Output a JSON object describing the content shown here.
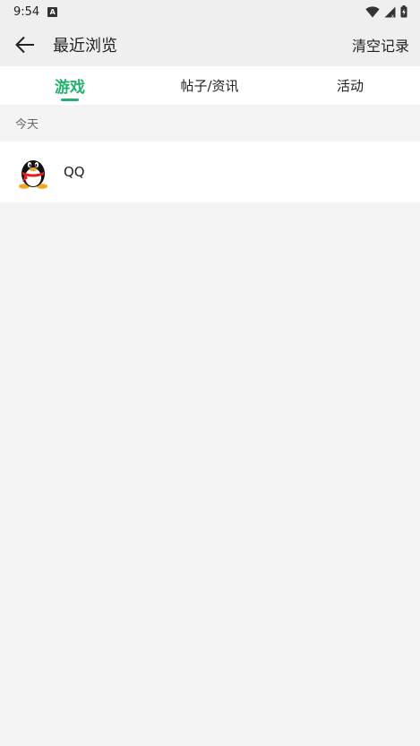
{
  "status_bar": {
    "time": "9:54",
    "notification_icon": "A"
  },
  "app_bar": {
    "title": "最近浏览",
    "clear_label": "清空记录"
  },
  "tabs": [
    {
      "label": "游戏",
      "active": true
    },
    {
      "label": "帖子/资讯",
      "active": false
    },
    {
      "label": "活动",
      "active": false
    }
  ],
  "colors": {
    "accent": "#23b26e",
    "background": "#f4f4f4",
    "header_bg": "#efefef"
  },
  "sections": [
    {
      "header": "今天",
      "items": [
        {
          "name": "QQ",
          "icon": "qq-penguin-icon"
        }
      ]
    }
  ]
}
